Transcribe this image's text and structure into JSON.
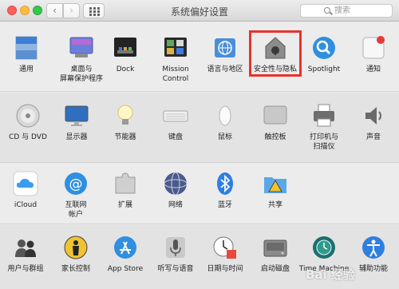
{
  "window": {
    "title": "系统偏好设置",
    "search_placeholder": "搜索",
    "back_glyph": "‹",
    "forward_glyph": "›"
  },
  "rows": [
    {
      "items": [
        {
          "label": "通用",
          "icon": "general-icon"
        },
        {
          "label": "桌面与\n屏幕保护程序",
          "icon": "desktop-screensaver-icon"
        },
        {
          "label": "Dock",
          "icon": "dock-icon"
        },
        {
          "label": "Mission\nControl",
          "icon": "mission-control-icon"
        },
        {
          "label": "语言与地区",
          "icon": "language-region-icon"
        },
        {
          "label": "安全性与隐私",
          "icon": "security-privacy-icon"
        },
        {
          "label": "Spotlight",
          "icon": "spotlight-icon"
        },
        {
          "label": "通知",
          "icon": "notifications-icon"
        }
      ]
    },
    {
      "items": [
        {
          "label": "CD 与 DVD",
          "icon": "cd-dvd-icon"
        },
        {
          "label": "显示器",
          "icon": "displays-icon"
        },
        {
          "label": "节能器",
          "icon": "energy-saver-icon"
        },
        {
          "label": "键盘",
          "icon": "keyboard-icon"
        },
        {
          "label": "鼠标",
          "icon": "mouse-icon"
        },
        {
          "label": "触控板",
          "icon": "trackpad-icon"
        },
        {
          "label": "打印机与\n扫描仪",
          "icon": "printers-scanners-icon"
        },
        {
          "label": "声音",
          "icon": "sound-icon"
        }
      ]
    },
    {
      "items": [
        {
          "label": "iCloud",
          "icon": "icloud-icon"
        },
        {
          "label": "互联网\n帐户",
          "icon": "internet-accounts-icon"
        },
        {
          "label": "扩展",
          "icon": "extensions-icon"
        },
        {
          "label": "网络",
          "icon": "network-icon"
        },
        {
          "label": "蓝牙",
          "icon": "bluetooth-icon"
        },
        {
          "label": "共享",
          "icon": "sharing-icon"
        }
      ]
    },
    {
      "items": [
        {
          "label": "用户与群组",
          "icon": "users-groups-icon"
        },
        {
          "label": "家长控制",
          "icon": "parental-controls-icon"
        },
        {
          "label": "App Store",
          "icon": "app-store-icon"
        },
        {
          "label": "听写与语音",
          "icon": "dictation-speech-icon"
        },
        {
          "label": "日期与时间",
          "icon": "date-time-icon"
        },
        {
          "label": "启动磁盘",
          "icon": "startup-disk-icon"
        },
        {
          "label": "Time Machine",
          "icon": "time-machine-icon"
        },
        {
          "label": "辅助功能",
          "icon": "accessibility-icon"
        }
      ]
    }
  ],
  "highlight": {
    "target": "安全性与隐私",
    "color": "#e8322d"
  },
  "watermark": "Bai 经验"
}
